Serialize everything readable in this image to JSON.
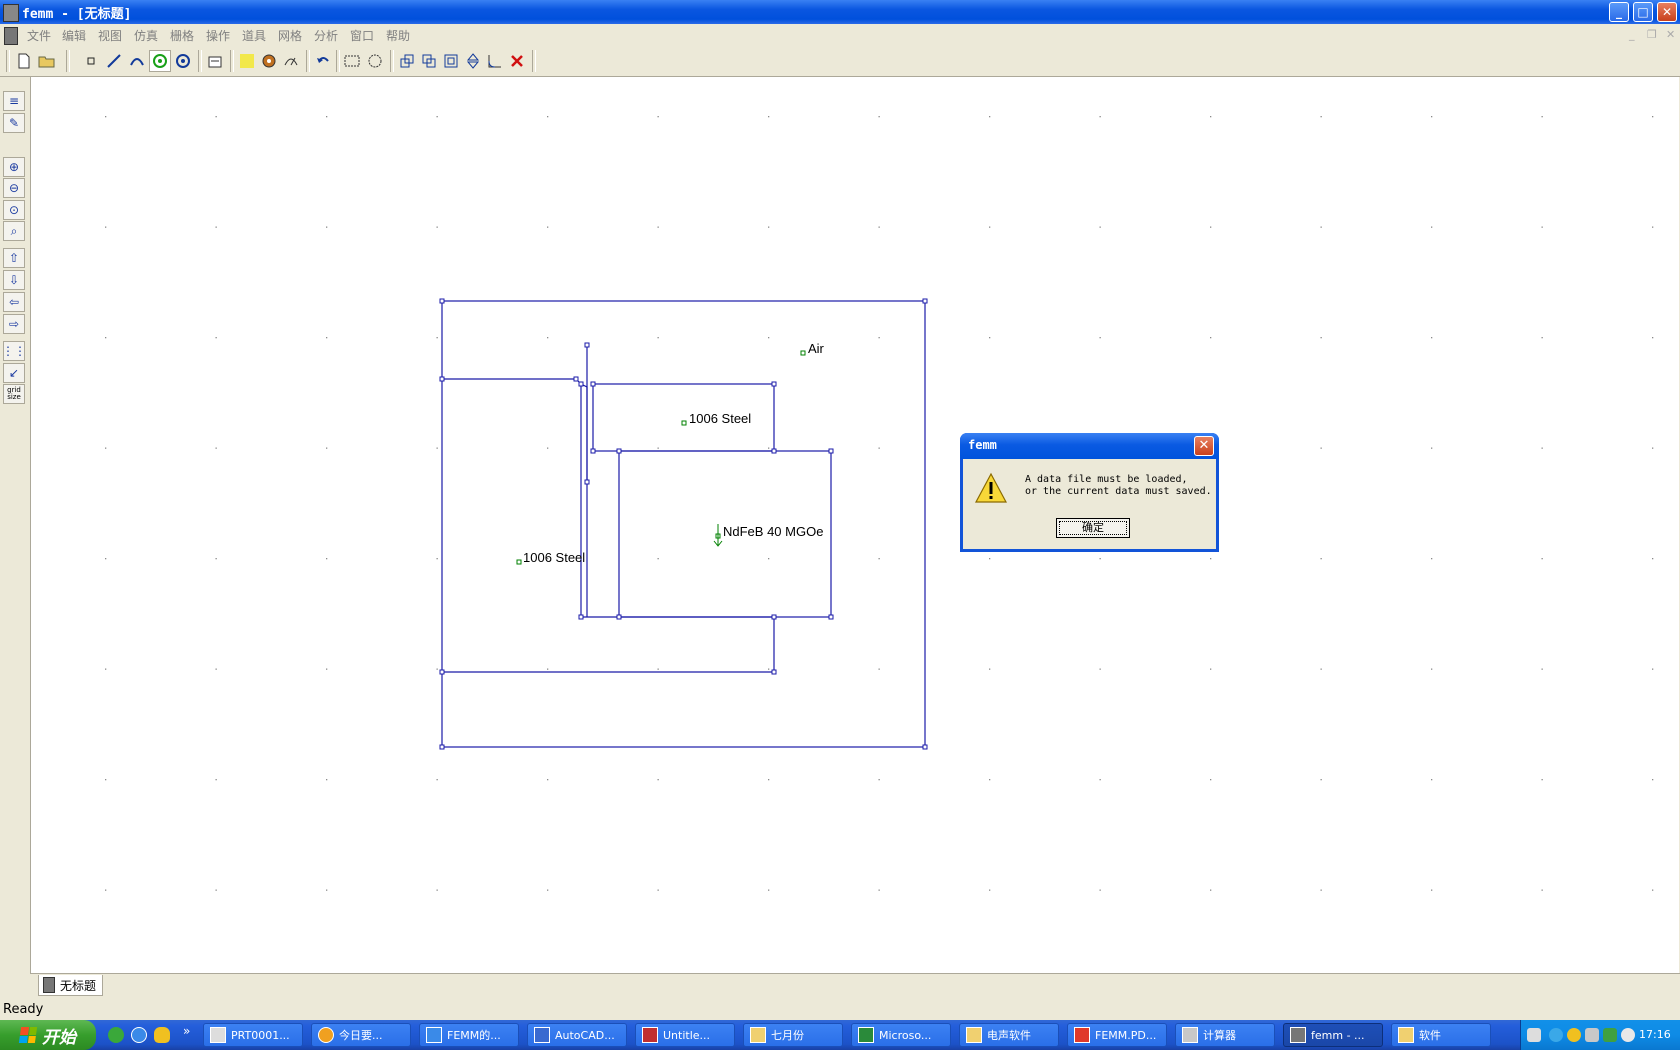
{
  "window": {
    "title": "femm - [无标题]",
    "controls": {
      "minimize": "_",
      "maximize": "□",
      "close": "✕"
    }
  },
  "menu": {
    "items": [
      "文件",
      "编辑",
      "视图",
      "仿真",
      "栅格",
      "操作",
      "道具",
      "网格",
      "分析",
      "窗口",
      "帮助"
    ]
  },
  "left_toolbar": {
    "grid_size_label": "grid size"
  },
  "canvas": {
    "labels": {
      "air": "Air",
      "steel_top": "1006 Steel",
      "steel_left": "1006 Steel",
      "magnet": "NdFeB 40 MGOe"
    }
  },
  "document_tab": {
    "label": "无标题"
  },
  "status_bar": {
    "text": "Ready"
  },
  "dialog": {
    "title": "femm",
    "message": "A data file must be loaded,\nor the current data must saved.",
    "ok_label": "确定",
    "close_glyph": "✕"
  },
  "taskbar": {
    "start_label": "开始",
    "overflow": "»",
    "tasks": [
      {
        "label": "PRT0001..."
      },
      {
        "label": "今日要..."
      },
      {
        "label": "FEMM的..."
      },
      {
        "label": "AutoCAD..."
      },
      {
        "label": "Untitle..."
      },
      {
        "label": "七月份"
      },
      {
        "label": "Microso..."
      },
      {
        "label": "电声软件"
      },
      {
        "label": "FEMM.PD..."
      },
      {
        "label": "计算器"
      },
      {
        "label": "femm - ..."
      },
      {
        "label": "软件"
      }
    ],
    "clock": "17:16"
  },
  "colors": {
    "geometry_line": "#1a1aa8",
    "block_label_marker": "#008000",
    "grid_dot": "#8a8a8a",
    "title_bar": "#0a56e0",
    "taskbar": "#245edb"
  }
}
